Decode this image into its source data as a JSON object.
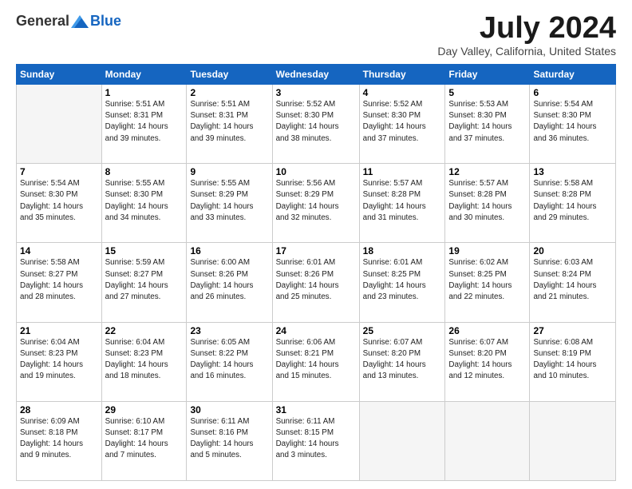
{
  "logo": {
    "general": "General",
    "blue": "Blue"
  },
  "title": "July 2024",
  "location": "Day Valley, California, United States",
  "days_of_week": [
    "Sunday",
    "Monday",
    "Tuesday",
    "Wednesday",
    "Thursday",
    "Friday",
    "Saturday"
  ],
  "weeks": [
    [
      {
        "day": "",
        "sunrise": "",
        "sunset": "",
        "daylight": ""
      },
      {
        "day": "1",
        "sunrise": "5:51 AM",
        "sunset": "8:31 PM",
        "daylight": "14 hours and 39 minutes."
      },
      {
        "day": "2",
        "sunrise": "5:51 AM",
        "sunset": "8:31 PM",
        "daylight": "14 hours and 39 minutes."
      },
      {
        "day": "3",
        "sunrise": "5:52 AM",
        "sunset": "8:30 PM",
        "daylight": "14 hours and 38 minutes."
      },
      {
        "day": "4",
        "sunrise": "5:52 AM",
        "sunset": "8:30 PM",
        "daylight": "14 hours and 37 minutes."
      },
      {
        "day": "5",
        "sunrise": "5:53 AM",
        "sunset": "8:30 PM",
        "daylight": "14 hours and 37 minutes."
      },
      {
        "day": "6",
        "sunrise": "5:54 AM",
        "sunset": "8:30 PM",
        "daylight": "14 hours and 36 minutes."
      }
    ],
    [
      {
        "day": "7",
        "sunrise": "5:54 AM",
        "sunset": "8:30 PM",
        "daylight": "14 hours and 35 minutes."
      },
      {
        "day": "8",
        "sunrise": "5:55 AM",
        "sunset": "8:30 PM",
        "daylight": "14 hours and 34 minutes."
      },
      {
        "day": "9",
        "sunrise": "5:55 AM",
        "sunset": "8:29 PM",
        "daylight": "14 hours and 33 minutes."
      },
      {
        "day": "10",
        "sunrise": "5:56 AM",
        "sunset": "8:29 PM",
        "daylight": "14 hours and 32 minutes."
      },
      {
        "day": "11",
        "sunrise": "5:57 AM",
        "sunset": "8:28 PM",
        "daylight": "14 hours and 31 minutes."
      },
      {
        "day": "12",
        "sunrise": "5:57 AM",
        "sunset": "8:28 PM",
        "daylight": "14 hours and 30 minutes."
      },
      {
        "day": "13",
        "sunrise": "5:58 AM",
        "sunset": "8:28 PM",
        "daylight": "14 hours and 29 minutes."
      }
    ],
    [
      {
        "day": "14",
        "sunrise": "5:58 AM",
        "sunset": "8:27 PM",
        "daylight": "14 hours and 28 minutes."
      },
      {
        "day": "15",
        "sunrise": "5:59 AM",
        "sunset": "8:27 PM",
        "daylight": "14 hours and 27 minutes."
      },
      {
        "day": "16",
        "sunrise": "6:00 AM",
        "sunset": "8:26 PM",
        "daylight": "14 hours and 26 minutes."
      },
      {
        "day": "17",
        "sunrise": "6:01 AM",
        "sunset": "8:26 PM",
        "daylight": "14 hours and 25 minutes."
      },
      {
        "day": "18",
        "sunrise": "6:01 AM",
        "sunset": "8:25 PM",
        "daylight": "14 hours and 23 minutes."
      },
      {
        "day": "19",
        "sunrise": "6:02 AM",
        "sunset": "8:25 PM",
        "daylight": "14 hours and 22 minutes."
      },
      {
        "day": "20",
        "sunrise": "6:03 AM",
        "sunset": "8:24 PM",
        "daylight": "14 hours and 21 minutes."
      }
    ],
    [
      {
        "day": "21",
        "sunrise": "6:04 AM",
        "sunset": "8:23 PM",
        "daylight": "14 hours and 19 minutes."
      },
      {
        "day": "22",
        "sunrise": "6:04 AM",
        "sunset": "8:23 PM",
        "daylight": "14 hours and 18 minutes."
      },
      {
        "day": "23",
        "sunrise": "6:05 AM",
        "sunset": "8:22 PM",
        "daylight": "14 hours and 16 minutes."
      },
      {
        "day": "24",
        "sunrise": "6:06 AM",
        "sunset": "8:21 PM",
        "daylight": "14 hours and 15 minutes."
      },
      {
        "day": "25",
        "sunrise": "6:07 AM",
        "sunset": "8:20 PM",
        "daylight": "14 hours and 13 minutes."
      },
      {
        "day": "26",
        "sunrise": "6:07 AM",
        "sunset": "8:20 PM",
        "daylight": "14 hours and 12 minutes."
      },
      {
        "day": "27",
        "sunrise": "6:08 AM",
        "sunset": "8:19 PM",
        "daylight": "14 hours and 10 minutes."
      }
    ],
    [
      {
        "day": "28",
        "sunrise": "6:09 AM",
        "sunset": "8:18 PM",
        "daylight": "14 hours and 9 minutes."
      },
      {
        "day": "29",
        "sunrise": "6:10 AM",
        "sunset": "8:17 PM",
        "daylight": "14 hours and 7 minutes."
      },
      {
        "day": "30",
        "sunrise": "6:11 AM",
        "sunset": "8:16 PM",
        "daylight": "14 hours and 5 minutes."
      },
      {
        "day": "31",
        "sunrise": "6:11 AM",
        "sunset": "8:15 PM",
        "daylight": "14 hours and 3 minutes."
      },
      {
        "day": "",
        "sunrise": "",
        "sunset": "",
        "daylight": ""
      },
      {
        "day": "",
        "sunrise": "",
        "sunset": "",
        "daylight": ""
      },
      {
        "day": "",
        "sunrise": "",
        "sunset": "",
        "daylight": ""
      }
    ]
  ]
}
